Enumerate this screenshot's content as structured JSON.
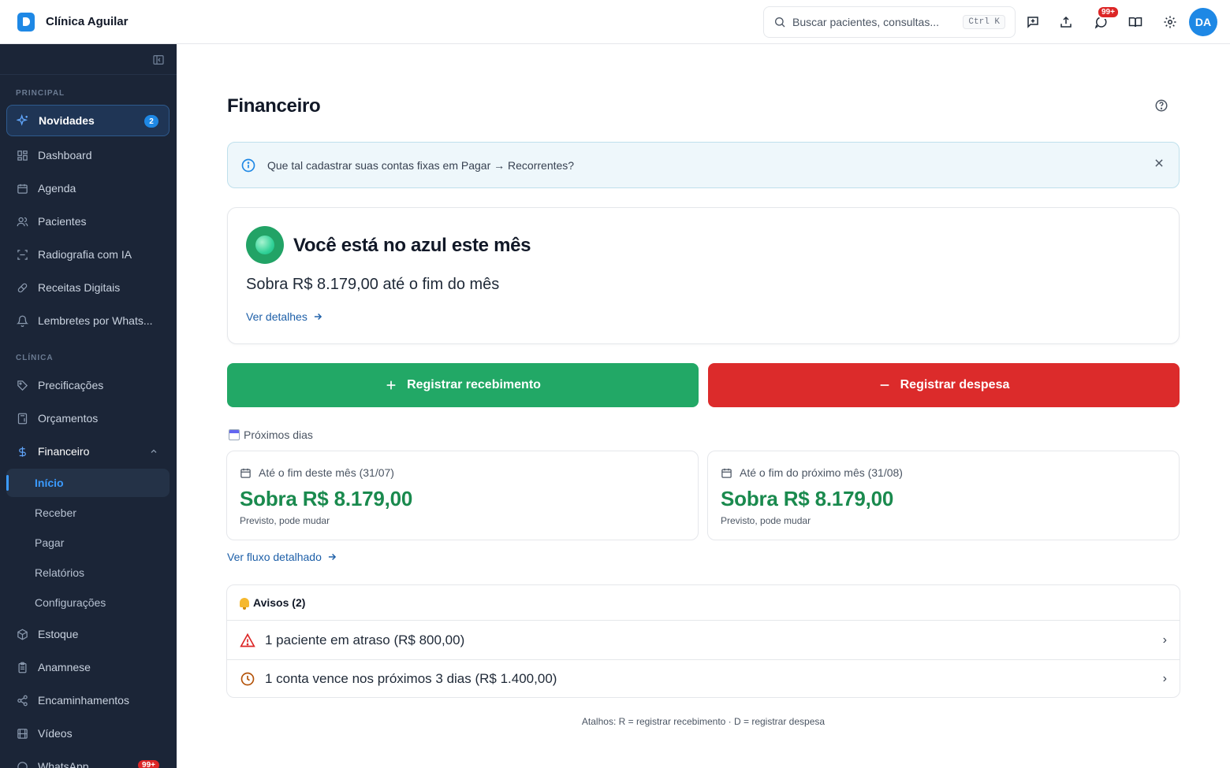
{
  "app": {
    "brand_name": "Clínica Aguilar"
  },
  "topbar": {
    "search_placeholder": "Buscar pacientes, consultas...",
    "search_shortcut": "Ctrl K",
    "notifications_badge": "99+",
    "avatar_initials": "DA"
  },
  "sidebar": {
    "section_principal": "PRINCIPAL",
    "section_clinica": "CLÍNICA",
    "items": [
      {
        "label": "Novidades",
        "icon": "sparkles-icon",
        "badge": "2"
      },
      {
        "label": "Dashboard",
        "icon": "grid-icon"
      },
      {
        "label": "Agenda",
        "icon": "calendar-icon"
      },
      {
        "label": "Pacientes",
        "icon": "users-icon"
      },
      {
        "label": "Radiografia com IA",
        "icon": "scan-icon"
      },
      {
        "label": "Receitas Digitais",
        "icon": "pill-icon"
      },
      {
        "label": "Lembretes por Whats...",
        "icon": "bell-icon"
      },
      {
        "label": "Precificações",
        "icon": "tag-icon"
      },
      {
        "label": "Orçamentos",
        "icon": "calculator-icon"
      },
      {
        "label": "Financeiro",
        "icon": "dollar-icon"
      },
      {
        "label": "Estoque",
        "icon": "box-icon"
      },
      {
        "label": "Anamnese",
        "icon": "clipboard-icon"
      },
      {
        "label": "Encaminhamentos",
        "icon": "share-icon"
      },
      {
        "label": "Vídeos",
        "icon": "film-icon"
      },
      {
        "label": "WhatsApp",
        "icon": "whatsapp-icon",
        "badge": "99+"
      }
    ],
    "financeiro_sub": [
      {
        "label": "Início"
      },
      {
        "label": "Receber"
      },
      {
        "label": "Pagar"
      },
      {
        "label": "Relatórios"
      },
      {
        "label": "Configurações"
      }
    ]
  },
  "main": {
    "title": "Financeiro",
    "tip": "Que tal cadastrar suas contas fixas em Pagar → Recorrentes?",
    "status": {
      "title": "Você está no azul este mês",
      "subtitle": "Sobra R$ 8.179,00 até o fim do mês",
      "details_link": "Ver detalhes"
    },
    "buttons": {
      "income": "Registrar recebimento",
      "expense": "Registrar despesa"
    },
    "next_days_label": "Próximos dias",
    "periods": [
      {
        "label": "Até o fim deste mês (31/07)",
        "amount": "Sobra R$ 8.179,00",
        "note": "Previsto, pode mudar"
      },
      {
        "label": "Até o fim do próximo mês (31/08)",
        "amount": "Sobra R$ 8.179,00",
        "note": "Previsto, pode mudar"
      }
    ],
    "flow_link": "Ver fluxo detalhado",
    "alerts": {
      "title": "Avisos (2)",
      "rows": [
        {
          "text": "1 paciente em atraso (R$ 800,00)",
          "icon": "warning-icon"
        },
        {
          "text": "1 conta vence nos próximos 3 dias (R$ 1.400,00)",
          "icon": "clock-icon"
        }
      ]
    },
    "footer_hint": "Atalhos: R = registrar recebimento · D = registrar despesa"
  },
  "colors": {
    "sidebar_bg": "#1b2537",
    "accent_blue": "#1e88e5",
    "income_green": "#22a866",
    "expense_red": "#dc2b2b",
    "amount_green": "#1a8a4e"
  }
}
